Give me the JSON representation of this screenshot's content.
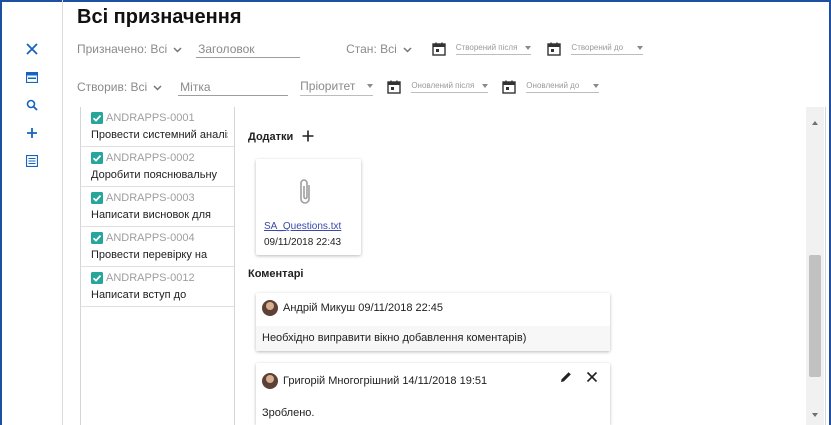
{
  "page": {
    "title": "Всі призначення"
  },
  "filters": {
    "assigned": {
      "label": "Призначено: Всі"
    },
    "title_field": {
      "placeholder": "Заголовок"
    },
    "state": {
      "label": "Стан: Всі"
    },
    "created_after": {
      "label": "Створений після"
    },
    "created_before": {
      "label": "Створений до"
    },
    "created_by": {
      "label": "Створив: Всі"
    },
    "tag_field": {
      "placeholder": "Мітка"
    },
    "priority": {
      "label": "Пріоритет"
    },
    "updated_after": {
      "label": "Оновлений після"
    },
    "updated_before": {
      "label": "Оновлений до"
    }
  },
  "rail": {
    "icons": [
      "close-icon",
      "calendar-view-icon",
      "search-icon",
      "add-icon",
      "list-icon"
    ]
  },
  "tasks": [
    {
      "id": "ANDRAPPS-0001",
      "name": "Провести системний аналіз"
    },
    {
      "id": "ANDRAPPS-0002",
      "name": "Доробити пояснювальну"
    },
    {
      "id": "ANDRAPPS-0003",
      "name": "Написати висновок для"
    },
    {
      "id": "ANDRAPPS-0004",
      "name": "Провести перевірку на"
    },
    {
      "id": "ANDRAPPS-0012",
      "name": "Написати вступ до"
    }
  ],
  "detail": {
    "attachments_title": "Додатки",
    "attachment": {
      "file_name": "SA_Questions.txt",
      "date": "09/11/2018 22:43"
    },
    "comments_title": "Коментарі",
    "comments": [
      {
        "author_line": "Андрій Микуш 09/11/2018 22:45",
        "text": "Необхідно виправити вікно добавлення коментарів)"
      },
      {
        "author_line": "Григорій Многогрішний 14/11/2018 19:51",
        "text": "Зроблено."
      }
    ]
  },
  "colors": {
    "accent": "#1565c0",
    "check": "#26a69a",
    "link": "#3949ab"
  }
}
